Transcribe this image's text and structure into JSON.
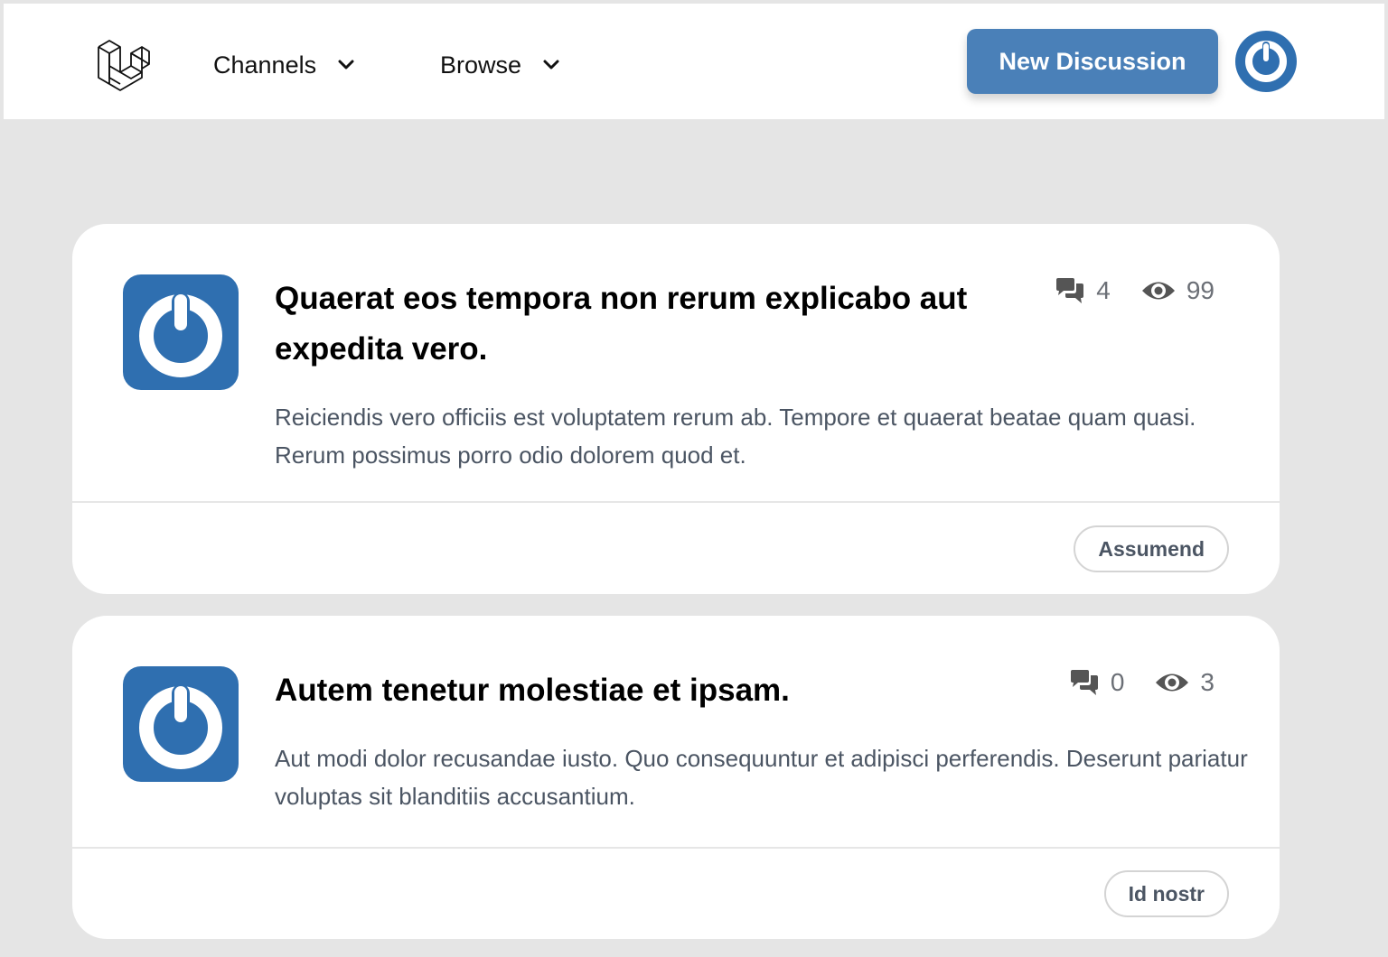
{
  "navbar": {
    "logo_icon": "laravel-logo-icon",
    "channels_label": "Channels",
    "browse_label": "Browse",
    "new_discussion_label": "New Discussion",
    "user_avatar_icon": "power-icon"
  },
  "colors": {
    "accent": "#4a80b8",
    "avatar_bg": "#2f6fb0",
    "page_bg": "#e5e5e5"
  },
  "discussions": [
    {
      "title": "Quaerat eos tempora non rerum explicabo aut expedita vero.",
      "replies": "4",
      "views": "99",
      "excerpt": "Reiciendis vero officiis est voluptatem rerum ab. Tempore et quaerat beatae quam quasi. Rerum possimus porro odio dolorem quod et.",
      "channel": "Assumend"
    },
    {
      "title": "Autem tenetur molestiae et ipsam.",
      "replies": "0",
      "views": "3",
      "excerpt": "Aut modi dolor recusandae iusto. Quo consequuntur et adipisci perferendis. Deserunt pariatur voluptas sit blanditiis accusantium.",
      "channel": "Id nostr"
    }
  ]
}
